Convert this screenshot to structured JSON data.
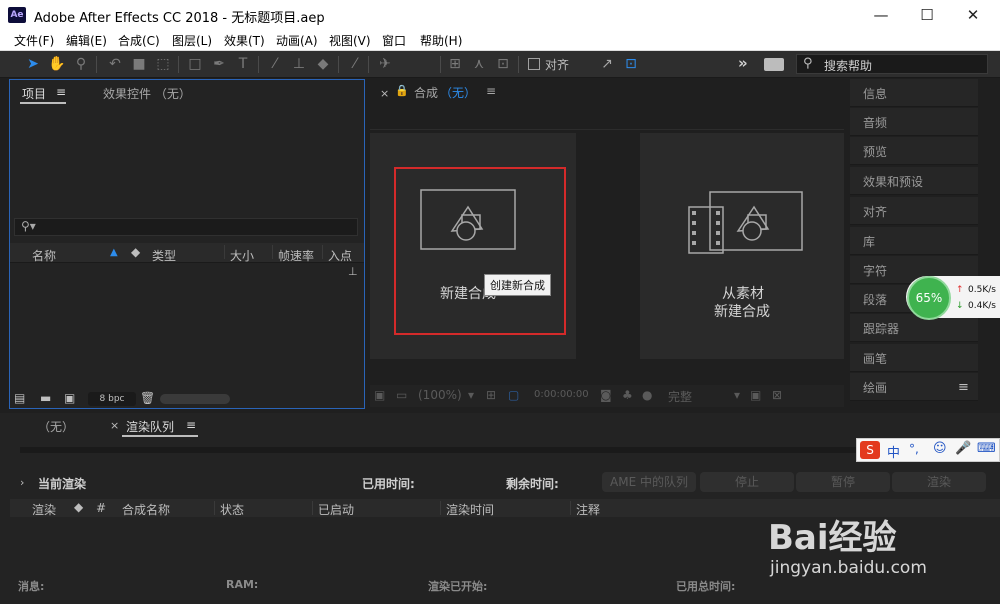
{
  "window": {
    "app_icon": "Ae",
    "title": "Adobe After Effects CC 2018 - 无标题项目.aep",
    "minimize_icon": "minimize-icon",
    "maximize_icon": "maximize-icon",
    "close_icon": "close-icon"
  },
  "menu": [
    "文件(F)",
    "编辑(E)",
    "合成(C)",
    "图层(L)",
    "效果(T)",
    "动画(A)",
    "视图(V)",
    "窗口",
    "帮助(H)"
  ],
  "toolbar": {
    "align_label": "对齐",
    "search_placeholder": "搜索帮助",
    "expand_label": "»"
  },
  "project_panel": {
    "tab_project": "项目",
    "tab_effects": "效果控件 （无）",
    "menu_icon": "≡",
    "columns": [
      "名称",
      "类型",
      "大小",
      "帧速率",
      "入点"
    ],
    "bpc": "8 bpc"
  },
  "comp_panel": {
    "tab_label": "合成",
    "tab_value": "（无）",
    "new_comp_label": "新建合成",
    "tooltip": "创建新合成",
    "from_footage_line1": "从素材",
    "from_footage_line2": "新建合成",
    "zoom": "(100%)",
    "timecode": "0:00:00:00",
    "resolution": "完整"
  },
  "right_panel": {
    "items": [
      "信息",
      "音频",
      "预览",
      "效果和预设",
      "对齐",
      "库",
      "字符",
      "段落",
      "跟踪器",
      "画笔",
      "绘画"
    ],
    "menu_icon": "≡"
  },
  "net_widget": {
    "percent": "65%",
    "up": "0.5K/s",
    "down": "0.4K/s"
  },
  "ime": {
    "items": [
      "中",
      "°,",
      "☺",
      "🎤",
      "⌨"
    ]
  },
  "render_queue": {
    "tab_none": "（无）",
    "tab_label": "渲染队列",
    "current_render": "当前渲染",
    "elapsed_label": "已用时间:",
    "remaining_label": "剩余时间:",
    "btn_ame": "AME 中的队列",
    "btn_stop": "停止",
    "btn_pause": "暂停",
    "btn_render": "渲染",
    "columns": [
      "渲染",
      "#",
      "合成名称",
      "状态",
      "已启动",
      "渲染时间",
      "注释"
    ],
    "footer": [
      "消息:",
      "RAM:",
      "渲染已开始:",
      "已用总时间:"
    ]
  },
  "watermark": {
    "line1": "Bai经验",
    "line2": "jingyan.baidu.com"
  }
}
